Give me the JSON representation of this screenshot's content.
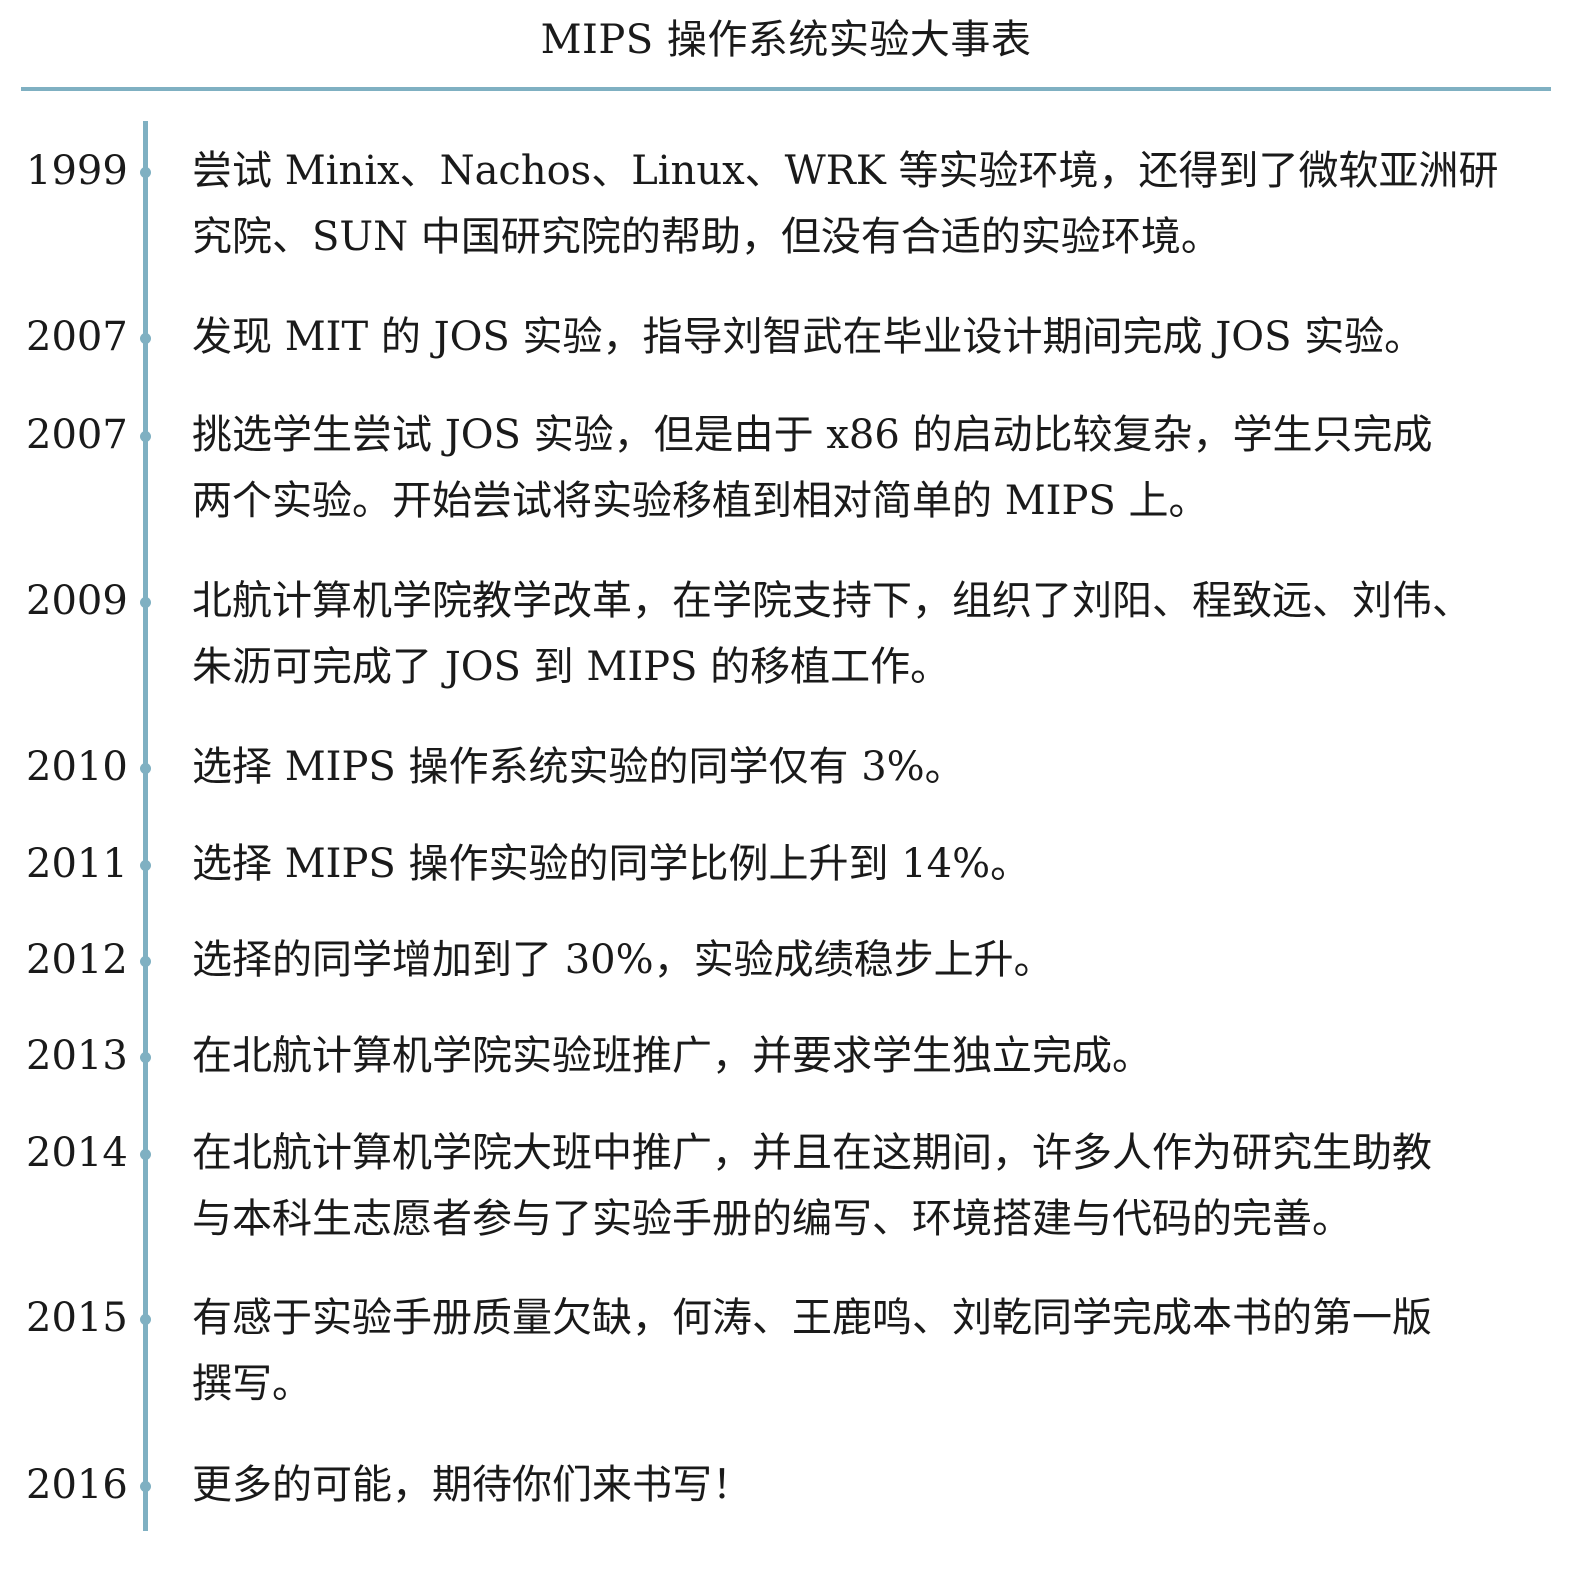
{
  "title": "MIPS 操作系统实验大事表",
  "colors": {
    "accent": "#7fb0c2",
    "text": "#1a1a1a",
    "background": "#ffffff"
  },
  "events": [
    {
      "year": "1999",
      "text": "尝试 Minix、Nachos、Linux、WRK 等实验环境，还得到了微软亚洲研\n究院、SUN 中国研究院的帮助，但没有合适的实验环境。"
    },
    {
      "year": "2007",
      "text": "发现 MIT 的 JOS 实验，指导刘智武在毕业设计期间完成 JOS 实验。"
    },
    {
      "year": "2007",
      "text": "挑选学生尝试 JOS 实验，但是由于 x86 的启动比较复杂，学生只完成\n两个实验。开始尝试将实验移植到相对简单的 MIPS 上。"
    },
    {
      "year": "2009",
      "text": "北航计算机学院教学改革，在学院支持下，组织了刘阳、程致远、刘伟、\n朱沥可完成了 JOS 到 MIPS 的移植工作。"
    },
    {
      "year": "2010",
      "text": "选择 MIPS 操作系统实验的同学仅有 3%。"
    },
    {
      "year": "2011",
      "text": "选择 MIPS 操作实验的同学比例上升到 14%。"
    },
    {
      "year": "2012",
      "text": "选择的同学增加到了 30%，实验成绩稳步上升。"
    },
    {
      "year": "2013",
      "text": "在北航计算机学院实验班推广，并要求学生独立完成。"
    },
    {
      "year": "2014",
      "text": "在北航计算机学院大班中推广，并且在这期间，许多人作为研究生助教\n与本科生志愿者参与了实验手册的编写、环境搭建与代码的完善。"
    },
    {
      "year": "2015",
      "text": "有感于实验手册质量欠缺，何涛、王鹿鸣、刘乾同学完成本书的第一版\n撰写。"
    },
    {
      "year": "2016",
      "text": "更多的可能，期待你们来书写！"
    }
  ]
}
